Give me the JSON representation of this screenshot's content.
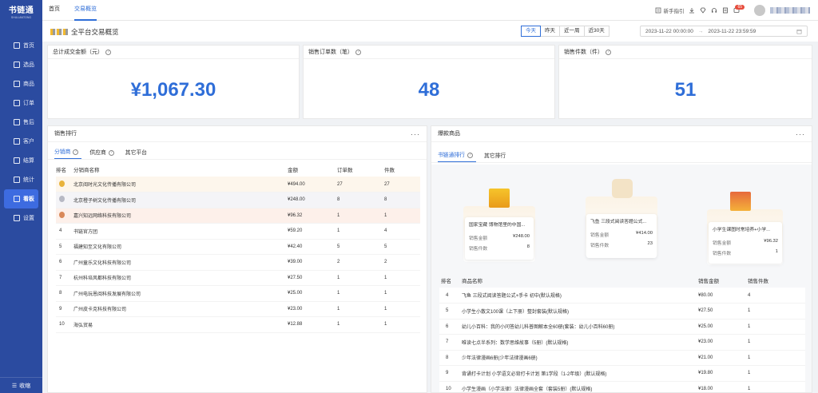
{
  "brand": {
    "name": "书链通",
    "sub": "SHULIANTONG"
  },
  "nav": [
    {
      "label": "首页",
      "icon": "monitor-icon"
    },
    {
      "label": "选品",
      "icon": "select-icon"
    },
    {
      "label": "商品",
      "icon": "product-icon"
    },
    {
      "label": "订单",
      "icon": "order-icon"
    },
    {
      "label": "售后",
      "icon": "aftersale-icon"
    },
    {
      "label": "客户",
      "icon": "customer-icon"
    },
    {
      "label": "结算",
      "icon": "settle-icon"
    },
    {
      "label": "统计",
      "icon": "stats-icon"
    },
    {
      "label": "看板",
      "icon": "dashboard-icon"
    },
    {
      "label": "设置",
      "icon": "settings-icon"
    }
  ],
  "collapse_label": "收缩",
  "tabs": {
    "home": "首页",
    "current": "交易概览"
  },
  "topbar": {
    "guide": "新手指引",
    "badge": "65"
  },
  "page_title": "全平台交易概览",
  "ranges": [
    "今天",
    "昨天",
    "近一周",
    "近30天"
  ],
  "date_range": {
    "start": "2023-11-22 00:00:00",
    "end": "2023-11-22 23:59:59"
  },
  "stats": [
    {
      "label": "总计成交金额（元）",
      "value": "¥1,067.30"
    },
    {
      "label": "销售订单数（笔）",
      "value": "48"
    },
    {
      "label": "销售件数（件）",
      "value": "51"
    }
  ],
  "sales_rank": {
    "title": "销售排行",
    "tabs": [
      "分销商",
      "供应商",
      "其它平台"
    ],
    "columns": [
      "排名",
      "分销商名称",
      "金额",
      "订单数",
      "件数"
    ],
    "rows": [
      {
        "rank": "1",
        "name": "北京阅时光文化传播有限公司",
        "amount": "¥494.00",
        "orders": "27",
        "qty": "27"
      },
      {
        "rank": "2",
        "name": "北京橙子树文化传播有限公司",
        "amount": "¥248.00",
        "orders": "8",
        "qty": "8"
      },
      {
        "rank": "3",
        "name": "嘉兴知远网络科技有限公司",
        "amount": "¥96.32",
        "orders": "1",
        "qty": "1"
      },
      {
        "rank": "4",
        "name": "书链官方团",
        "amount": "¥59.20",
        "orders": "1",
        "qty": "4"
      },
      {
        "rank": "5",
        "name": "福建知至文化有限公司",
        "amount": "¥42.40",
        "orders": "5",
        "qty": "5"
      },
      {
        "rank": "6",
        "name": "广州童乐文化科技有限公司",
        "amount": "¥39.00",
        "orders": "2",
        "qty": "2"
      },
      {
        "rank": "7",
        "name": "杭州科培风都科技有限公司",
        "amount": "¥27.50",
        "orders": "1",
        "qty": "1"
      },
      {
        "rank": "8",
        "name": "广州电玩恩阅科技发展有限公司",
        "amount": "¥25.00",
        "orders": "1",
        "qty": "1"
      },
      {
        "rank": "9",
        "name": "广州皮卡克科技有限公司",
        "amount": "¥23.00",
        "orders": "1",
        "qty": "1"
      },
      {
        "rank": "10",
        "name": "海弘贸易",
        "amount": "¥12.88",
        "orders": "1",
        "qty": "1"
      }
    ]
  },
  "hot": {
    "title": "爆款商品",
    "tabs": [
      "书链通排行",
      "其它排行"
    ],
    "amount_label": "销售金额",
    "qty_label": "销售件数",
    "podium": [
      {
        "name": "国家宝藏 博物馆里的中国...",
        "amount": "¥248.00",
        "qty": "8"
      },
      {
        "name": "飞鱼 三段式阅读答题公式...",
        "amount": "¥414.00",
        "qty": "23"
      },
      {
        "name": "小学生课图时常培养+小学...",
        "amount": "¥96.32",
        "qty": "1"
      }
    ],
    "columns": [
      "排名",
      "商品名称",
      "销售金额",
      "销售件数"
    ],
    "rows": [
      {
        "rank": "4",
        "name": "飞鱼 三段式阅读答题公式+手卡 初中(默认规格)",
        "amount": "¥80.00",
        "qty": "4"
      },
      {
        "rank": "5",
        "name": "小学生小散文100课（上下册）整封套装(默认规格)",
        "amount": "¥27.50",
        "qty": "1"
      },
      {
        "rank": "6",
        "name": "幼儿小百科：我的小问答幼儿科普图解本全60册(套装：幼儿小百科60册)",
        "amount": "¥25.00",
        "qty": "1"
      },
      {
        "rank": "7",
        "name": "唯读七点半系列：数学思维故事（5册）(默认规格)",
        "amount": "¥23.00",
        "qty": "1"
      },
      {
        "rank": "8",
        "name": "少年法律漫画6册(少年法律漫画6册)",
        "amount": "¥21.00",
        "qty": "1"
      },
      {
        "rank": "9",
        "name": "背诵打卡计划 小学语文必背打卡计划 第1学段（1-2年级）(默认规格)",
        "amount": "¥19.80",
        "qty": "1"
      },
      {
        "rank": "10",
        "name": "小学生漫画（小学法律）法律漫画全套（套装5册）(默认规格)",
        "amount": "¥18.00",
        "qty": "1"
      }
    ]
  },
  "colors": {
    "sidebar": "#2b4ba0",
    "accent": "#2f6ed8",
    "gold": "#e8b33c",
    "silver": "#b7b9c4",
    "bronze": "#d9895a"
  }
}
